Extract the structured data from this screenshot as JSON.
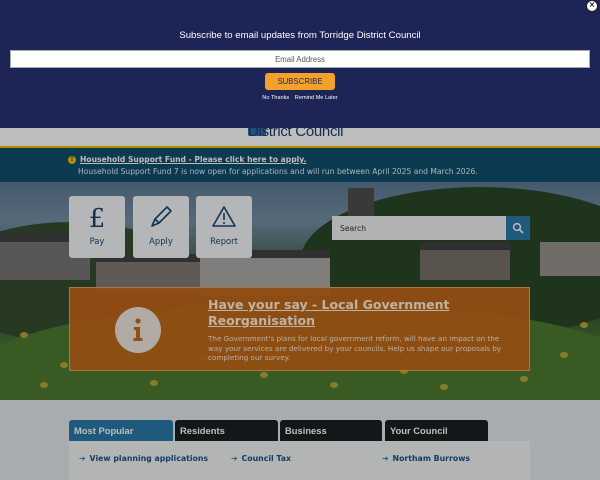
{
  "site": {
    "logo_text": "District Council"
  },
  "alert": {
    "icon": "info-icon",
    "link_text": "Household Support Fund - Please click here to apply.",
    "text": "Household Support Fund 7 is now open for applications and will run between April 2025 and March 2026."
  },
  "quick_links": [
    {
      "label": "Pay",
      "icon": "pound-sign-icon"
    },
    {
      "label": "Apply",
      "icon": "pencil-icon"
    },
    {
      "label": "Report",
      "icon": "warning-icon"
    }
  ],
  "search": {
    "placeholder": "Search",
    "button_icon": "search-icon"
  },
  "promo": {
    "icon": "info-icon",
    "title": "Have your say - Local Government Reorganisation",
    "text": "The Government's plans for local government reform, will have an impact on the way your services are delivered by your councils. Help us shape our proposals by completing our survey."
  },
  "tabs": [
    {
      "label": "Most Popular",
      "active": true
    },
    {
      "label": "Residents",
      "active": false
    },
    {
      "label": "Business",
      "active": false
    },
    {
      "label": "Your Council",
      "active": false
    }
  ],
  "panel_links": [
    "View planning applications",
    "Council Tax",
    "Northam Burrows"
  ],
  "modal": {
    "title": "Subscribe to email updates from Torridge District Council",
    "email_placeholder": "Email Address",
    "subscribe_label": "SUBSCRIBE",
    "no_thanks": "No Thanks",
    "remind_later": "Remind Me Later",
    "close_icon": "close-icon"
  },
  "colors": {
    "modal_bg": "#1d2456",
    "subscribe_accent": "#f2a12b",
    "alert_bg": "#0f4f6e",
    "promo_bg": "#c86819",
    "tab_active": "#2a78a8"
  }
}
